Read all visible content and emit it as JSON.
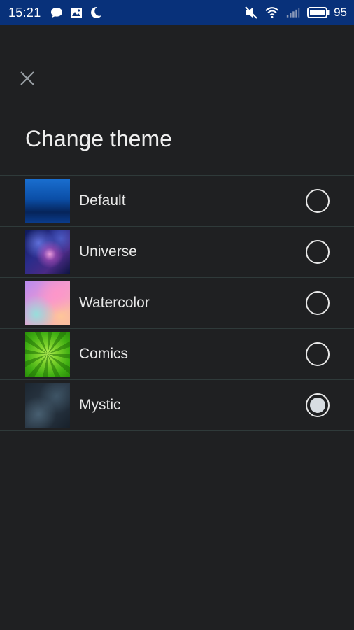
{
  "status_bar": {
    "time": "15:21",
    "battery": "95",
    "icons": [
      "chat-bubble-icon",
      "image-icon",
      "moon-icon",
      "mute-icon",
      "wifi-icon",
      "signal-icon",
      "battery-icon"
    ]
  },
  "header": {
    "close_icon": "close-icon",
    "title": "Change theme"
  },
  "themes": [
    {
      "label": "Default",
      "selected": false
    },
    {
      "label": "Universe",
      "selected": false
    },
    {
      "label": "Watercolor",
      "selected": false
    },
    {
      "label": "Comics",
      "selected": false
    },
    {
      "label": "Mystic",
      "selected": true
    }
  ],
  "colors": {
    "status_bar_bg": "#08317a",
    "background": "#1f2022",
    "divider": "#2f3a3a",
    "text": "#e8e8e8"
  }
}
